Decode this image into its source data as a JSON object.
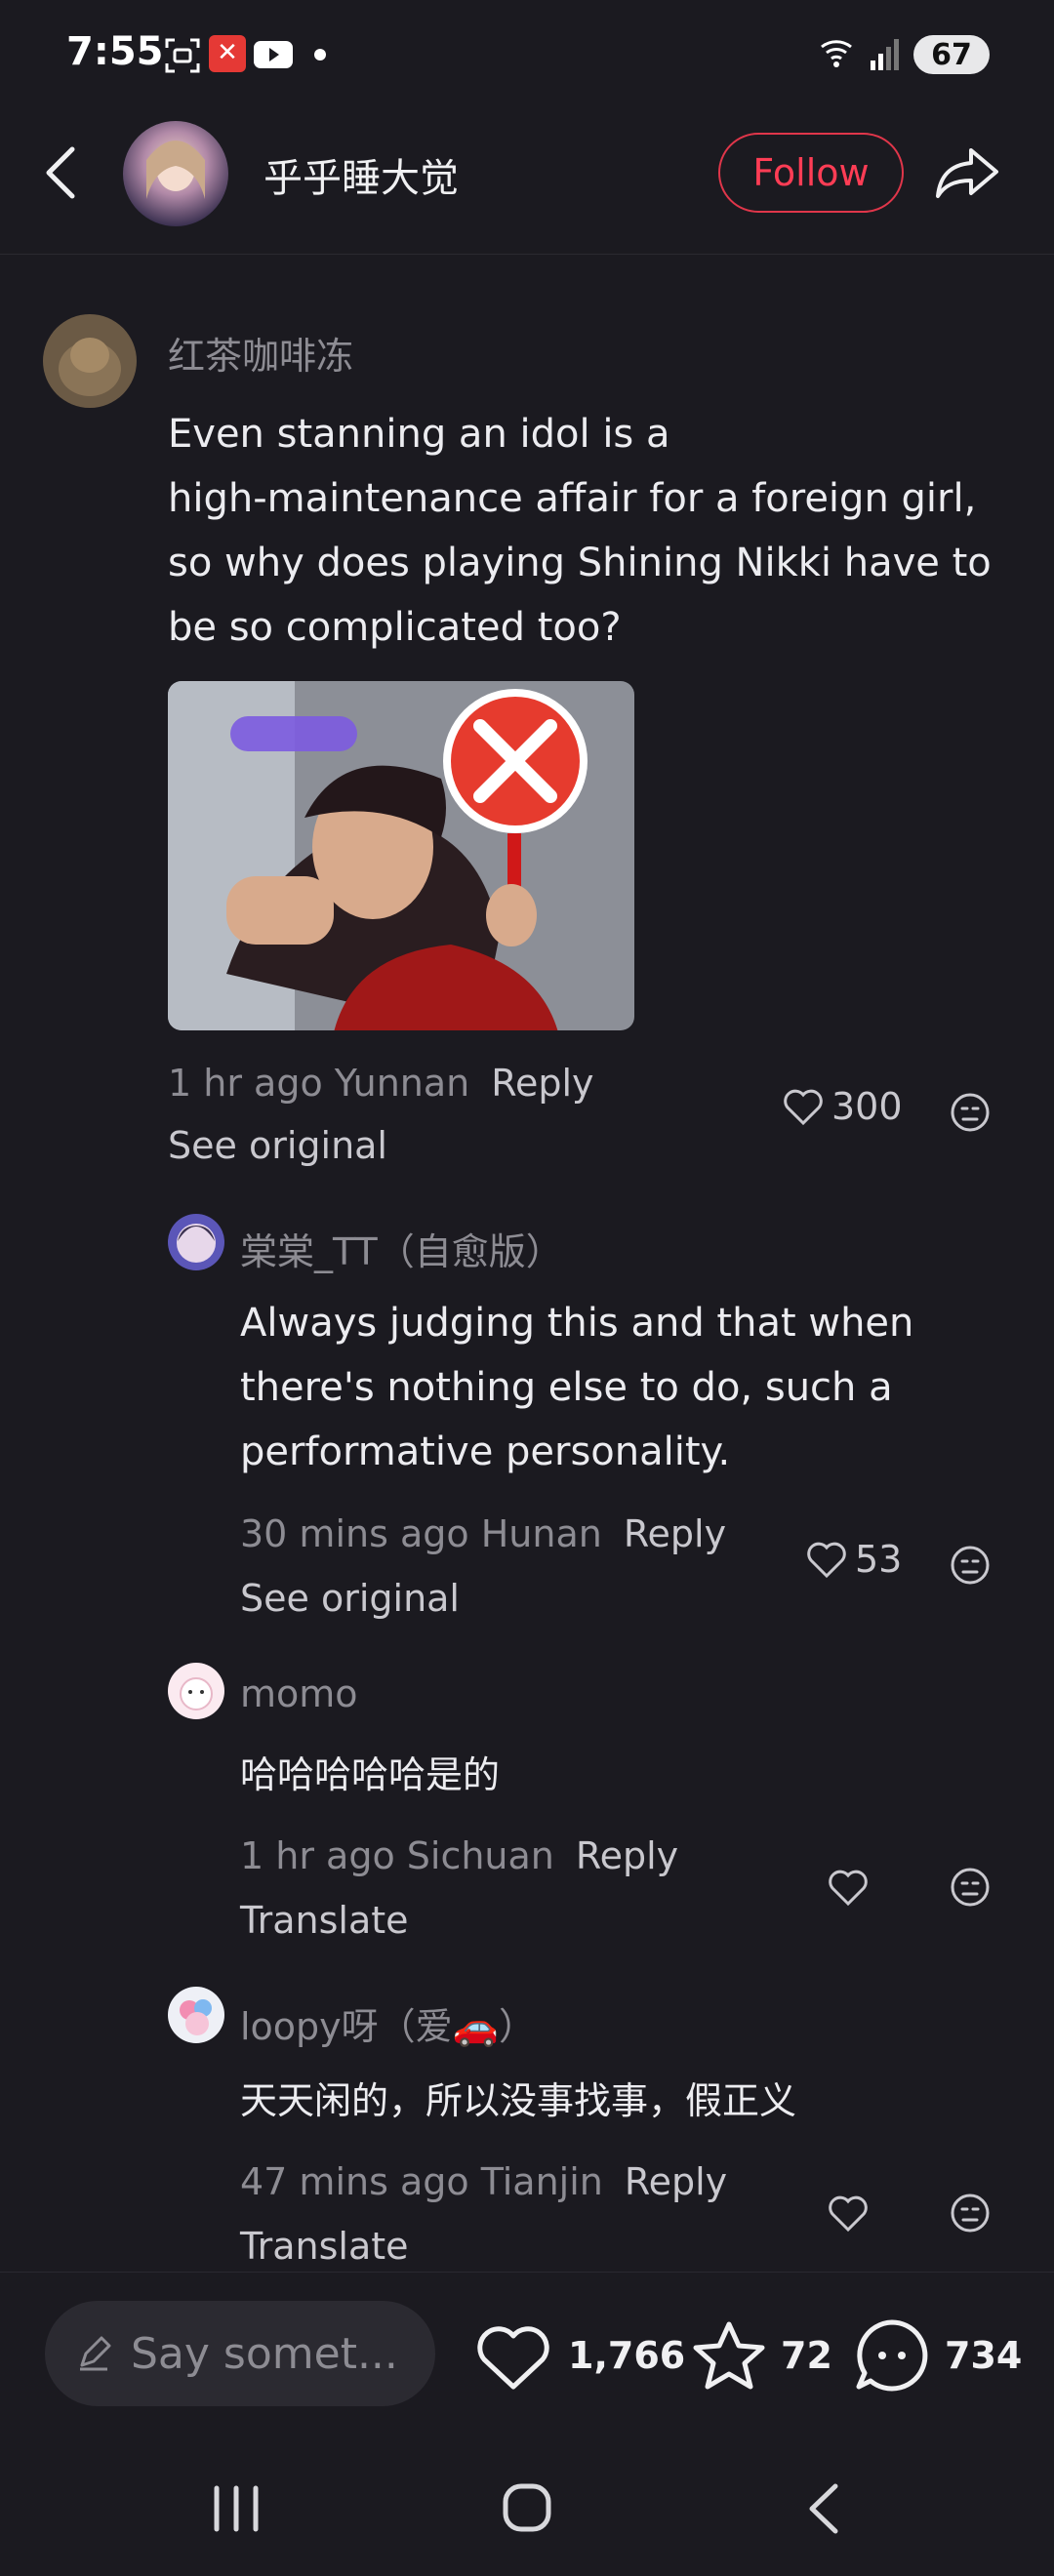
{
  "status_bar": {
    "time": "7:55",
    "battery": "67",
    "notification_icons": [
      "scan-icon",
      "x-app-icon",
      "youtube-icon",
      "dot-icon"
    ],
    "system_icons": [
      "wifi-icon",
      "signal-icon",
      "battery-icon"
    ]
  },
  "header": {
    "username": "乎乎睡大觉",
    "follow_label": "Follow"
  },
  "comments": [
    {
      "author": "红茶咖啡冻",
      "text_lines": [
        "Even stanning an idol is a",
        "high-maintenance affair for a foreign girl,",
        "so why does playing Shining Nikki have to",
        "be so complicated too?"
      ],
      "meta": "1 hr ago Yunnan",
      "reply": "Reply",
      "secondary": "See original",
      "likes": "300"
    },
    {
      "author": "棠棠_TT（自愈版）",
      "text_lines": [
        "Always judging this and that when",
        "there's nothing else to do, such a",
        "performative personality."
      ],
      "meta": "30 mins ago Hunan",
      "reply": "Reply",
      "secondary": "See original",
      "likes": "53"
    },
    {
      "author": "momo",
      "text_lines": [
        "哈哈哈哈哈是的"
      ],
      "meta": "1 hr ago Sichuan",
      "reply": "Reply",
      "secondary": "Translate",
      "likes": ""
    },
    {
      "author": "loopy呀（爱🚗）",
      "text_lines": [
        "天天闲的，所以没事找事，假正义"
      ],
      "meta": "47 mins ago Tianjin",
      "reply": "Reply",
      "secondary": "Translate",
      "likes": ""
    }
  ],
  "bottom_bar": {
    "input_placeholder": "Say somet...",
    "likes": "1,766",
    "favorites": "72",
    "comments": "734"
  },
  "colors": {
    "background": "#1b1a20",
    "accent": "#ff3d55",
    "muted_text": "#8d8c93"
  }
}
